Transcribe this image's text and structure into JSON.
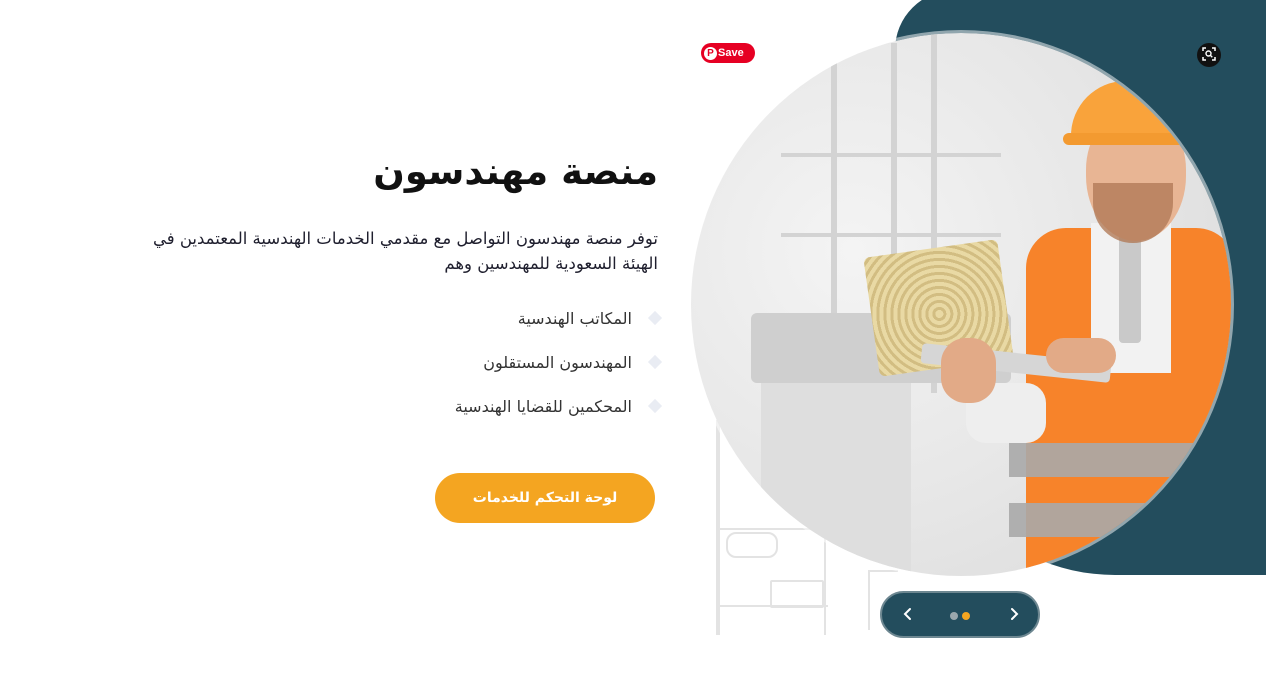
{
  "hero": {
    "title": "منصة مهندسون",
    "description": "توفر منصة مهندسون التواصل مع مقدمي الخدمات الهندسية المعتمدين في الهيئة السعودية للمهندسين وهم",
    "features": [
      "المكاتب الهندسية",
      "المهندسون المستقلون",
      "المحكمين للقضايا الهندسية"
    ],
    "cta_label": "لوحة التحكم للخدمات"
  },
  "overlay": {
    "save_label": "Save",
    "save_icon": "pinterest-icon",
    "lens_icon": "visual-search-icon"
  },
  "slider": {
    "prev_icon": "chevron-left-icon",
    "next_icon": "chevron-right-icon",
    "total_slides": 2,
    "active_slide": 2
  },
  "colors": {
    "accent": "#f4a521",
    "teal": "#234d5d",
    "pinterest_red": "#e60023"
  }
}
